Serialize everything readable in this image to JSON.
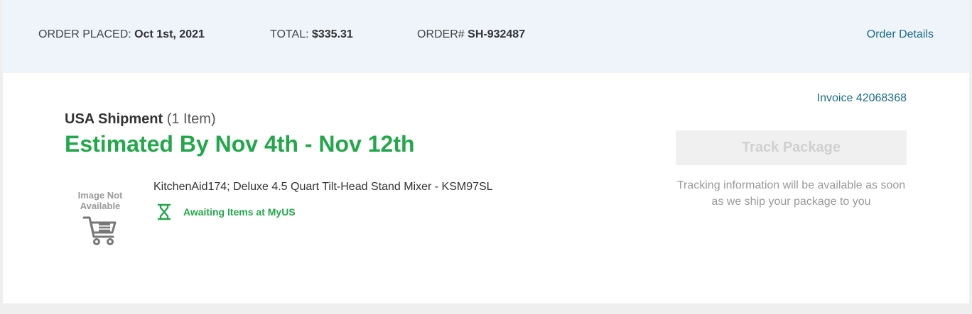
{
  "order": {
    "placed_label": "ORDER PLACED:",
    "placed_value": "Oct 1st, 2021",
    "total_label": "TOTAL:",
    "total_value": "$335.31",
    "number_label": "ORDER#",
    "number_value": "SH-932487",
    "details_link": "Order Details"
  },
  "shipment": {
    "invoice_link": "Invoice 42068368",
    "title": "USA Shipment",
    "item_count": "(1 Item)",
    "estimate": "Estimated By Nov 4th - Nov 12th",
    "item": {
      "image_placeholder": "Image Not Available",
      "image_icon": "shopping-cart-icon",
      "name": "KitchenAid174; Deluxe 4.5 Quart Tilt-Head Stand Mixer - KSM97SL",
      "status_icon": "hourglass-icon",
      "status": "Awaiting Items at MyUS"
    },
    "track_button": "Track Package",
    "track_note": "Tracking information will be available as soon as we ship your package to you"
  },
  "colors": {
    "accent_green": "#22a84a",
    "link_blue": "#1b6b87",
    "header_bg": "#eef4fa",
    "disabled_button_bg": "#f0f0f0"
  }
}
